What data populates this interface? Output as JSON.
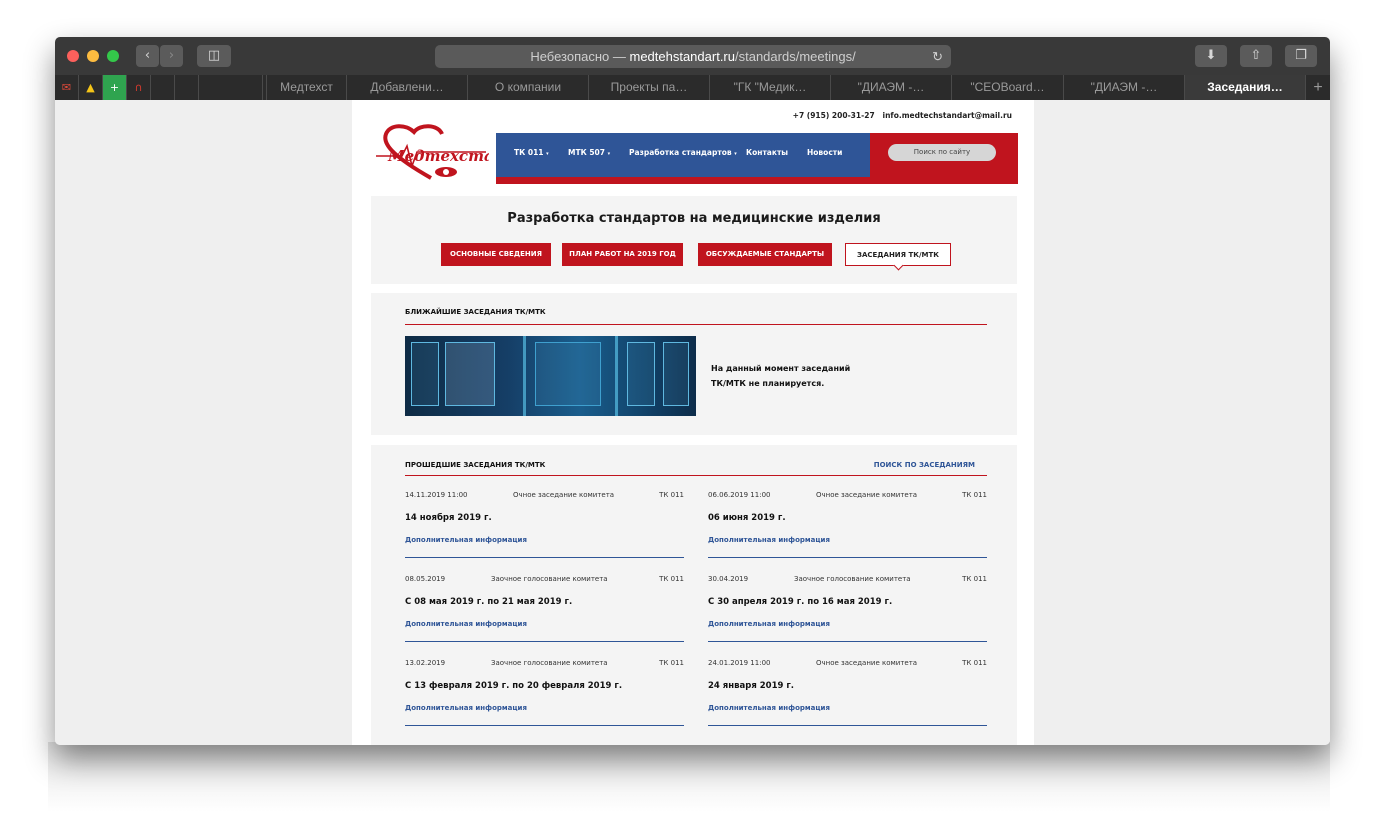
{
  "browser": {
    "url_prefix": "Небезопасно — ",
    "url_domain": "medtehstandart.ru",
    "url_path": "/standards/meetings/",
    "tabs": [
      "Медтехст",
      "Добавлени…",
      "О компании",
      "Проекты па…",
      "\"ГК \"Медик…",
      "\"ДИАЭМ -…",
      "\"CEOBoard…",
      "\"ДИАЭМ -…",
      "Заседания…"
    ],
    "active_tab_index": 8,
    "colors": {
      "toolbar": "#393939",
      "tabbar": "#2b2b2b"
    }
  },
  "site": {
    "phone": "+7 (915) 200-31-27",
    "email": "info.medtechstandart@mail.ru",
    "logo_text": "Медтехстандарт",
    "nav": [
      "ТК 011",
      "МТК 507",
      "Разработка стандартов",
      "Контакты",
      "Новости"
    ],
    "search_placeholder": "Поиск по сайту",
    "colors": {
      "brand_red": "#c0141e",
      "brand_blue": "#2f5597"
    }
  },
  "hero": {
    "title": "Разработка стандартов на медицинские изделия",
    "tabs": [
      "ОСНОВНЫЕ СВЕДЕНИЯ",
      "ПЛАН РАБОТ НА 2019 ГОД",
      "ОБСУЖДАЕМЫЕ СТАНДАРТЫ",
      "ЗАСЕДАНИЯ ТК/МТК"
    ],
    "active_tab_index": 3
  },
  "upcoming": {
    "heading": "БЛИЖАЙШИЕ ЗАСЕДАНИЯ ТК/МТК",
    "message_line1": "На данный момент заседаний",
    "message_line2": "ТК/МТК не планируется."
  },
  "past": {
    "heading": "ПРОШЕДШИЕ ЗАСЕДАНИЯ ТК/МТК",
    "search_link": "ПОИСК ПО ЗАСЕДАНИЯМ",
    "meetings": [
      {
        "date": "14.11.2019  11:00",
        "type": "Очное заседание комитета",
        "committee": "ТК 011",
        "title": "14 ноября 2019 г.",
        "more": "Дополнительная информация"
      },
      {
        "date": "06.06.2019  11:00",
        "type": "Очное заседание комитета",
        "committee": "ТК 011",
        "title": "06 июня 2019 г.",
        "more": "Дополнительная информация"
      },
      {
        "date": "08.05.2019",
        "type": "Заочное голосование комитета",
        "committee": "ТК 011",
        "title": "С 08 мая 2019 г. по 21 мая 2019 г.",
        "more": "Дополнительная информация"
      },
      {
        "date": "30.04.2019",
        "type": "Заочное голосование комитета",
        "committee": "ТК 011",
        "title": "С 30 апреля 2019 г. по 16 мая 2019 г.",
        "more": "Дополнительная информация"
      },
      {
        "date": "13.02.2019",
        "type": "Заочное голосование комитета",
        "committee": "ТК 011",
        "title": "С 13 февраля 2019 г. по 20 февраля 2019 г.",
        "more": "Дополнительная информация"
      },
      {
        "date": "24.01.2019  11:00",
        "type": "Очное заседание комитета",
        "committee": "ТК 011",
        "title": "24 января 2019 г.",
        "more": "Дополнительная информация"
      }
    ]
  }
}
